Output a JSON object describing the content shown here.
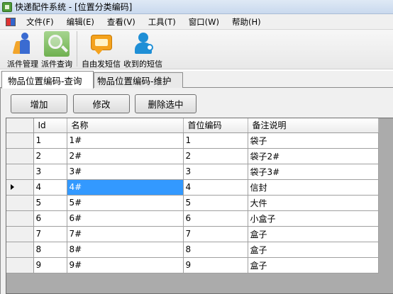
{
  "window": {
    "title": "快递配件系统 - [位置分类编码]"
  },
  "menu": {
    "items": [
      "文件(F)",
      "编辑(E)",
      "查看(V)",
      "工具(T)",
      "窗口(W)",
      "帮助(H)"
    ]
  },
  "toolbar": {
    "dispatch_manage": "派件管理",
    "dispatch_query": "派件查询",
    "free_sms": "自由发短信",
    "received_sms": "收到的短信"
  },
  "tabs": [
    {
      "label": "物品位置编码-查询",
      "active": true
    },
    {
      "label": "物品位置编码-维护",
      "active": false
    }
  ],
  "actions": {
    "add": "增加",
    "edit": "修改",
    "delete_selected": "删除选中"
  },
  "grid": {
    "columns": [
      "Id",
      "名称",
      "首位编码",
      "备注说明"
    ],
    "rows": [
      [
        "1",
        "1#",
        "1",
        "袋子"
      ],
      [
        "2",
        "2#",
        "2",
        "袋子2#"
      ],
      [
        "3",
        "3#",
        "3",
        "袋子3#"
      ],
      [
        "4",
        "4#",
        "4",
        "信封"
      ],
      [
        "5",
        "5#",
        "5",
        "大件"
      ],
      [
        "6",
        "6#",
        "6",
        "小盒子"
      ],
      [
        "7",
        "7#",
        "7",
        "盒子"
      ],
      [
        "8",
        "8#",
        "8",
        "盒子"
      ],
      [
        "9",
        "9#",
        "9",
        "盒子"
      ]
    ],
    "current_row": 3,
    "selected_cell": [
      3,
      1
    ],
    "selection_color": "#3399ff"
  }
}
